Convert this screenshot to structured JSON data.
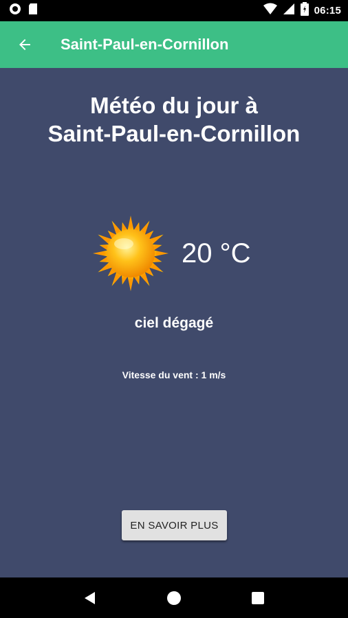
{
  "status_bar": {
    "time": "06:15",
    "icons": [
      "circle-notification-icon",
      "sd-card-icon",
      "wifi-icon",
      "signal-icon",
      "battery-icon"
    ]
  },
  "app_bar": {
    "title": "Saint-Paul-en-Cornillon",
    "back_icon": "arrow-left-icon",
    "color": "#3dbf86"
  },
  "main": {
    "heading_line1": "Météo du jour à",
    "heading_line2": "Saint-Paul-en-Cornillon",
    "weather_icon": "sun-icon",
    "temperature": "20 °C",
    "condition": "ciel dégagé",
    "wind": "Vitesse du vent : 1 m/s",
    "more_button": "EN SAVOIR PLUS",
    "background": "#404a6b"
  },
  "nav_bar": {
    "icons": [
      "back-triangle-icon",
      "home-circle-icon",
      "recents-square-icon"
    ]
  }
}
